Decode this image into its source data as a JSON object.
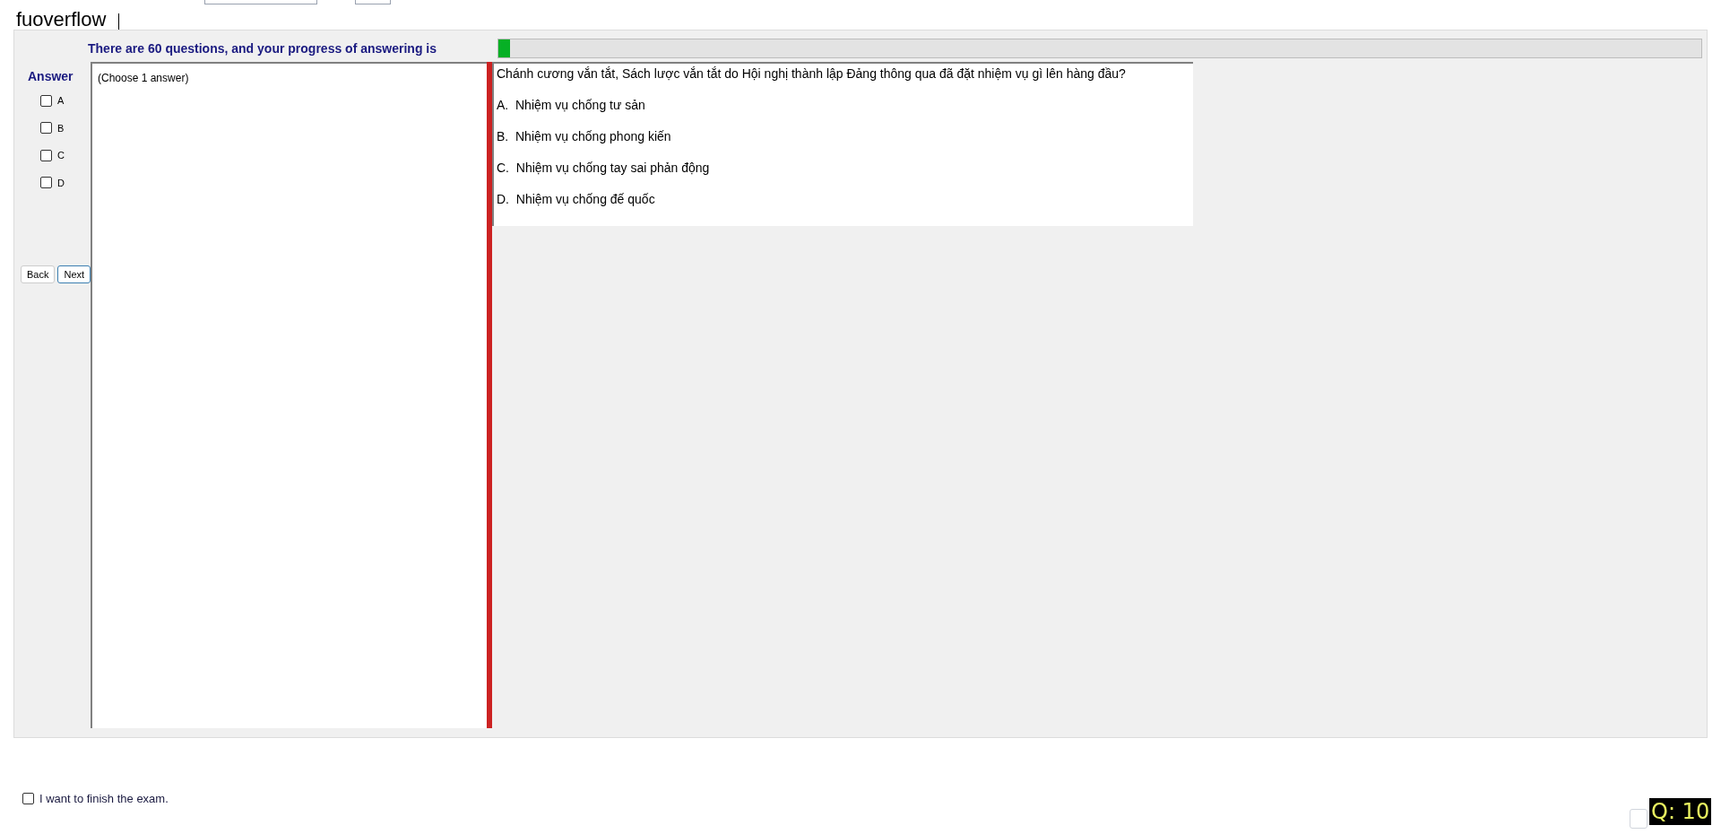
{
  "header": {
    "title": "fuoverflow"
  },
  "progress": {
    "label": "There are 60 questions, and your progress of answering is",
    "level": 0.01
  },
  "answer_panel": {
    "title": "Answer",
    "options": [
      {
        "label": "A",
        "checked": false
      },
      {
        "label": "B",
        "checked": false
      },
      {
        "label": "C",
        "checked": false
      },
      {
        "label": "D",
        "checked": false
      }
    ],
    "buttons": [
      "Back",
      "Next"
    ]
  },
  "instruction": "(Choose 1 answer)",
  "question": {
    "text": "Chánh cương vắn tắt, Sách lược vắn tắt do Hội nghị thành lập Đảng thông qua đã đặt nhiệm vụ gì lên hàng đầu?",
    "choices": [
      "A.  Nhiệm vụ chống tư sản",
      "B.  Nhiệm vụ chống phong kiến",
      "C.  Nhiệm vụ chống tay sai phản động",
      "D.  Nhiệm vụ chống đế quốc"
    ]
  },
  "finish": {
    "label": "I want to finish the exam.",
    "checked": false
  },
  "question_counter": "Q: 10"
}
